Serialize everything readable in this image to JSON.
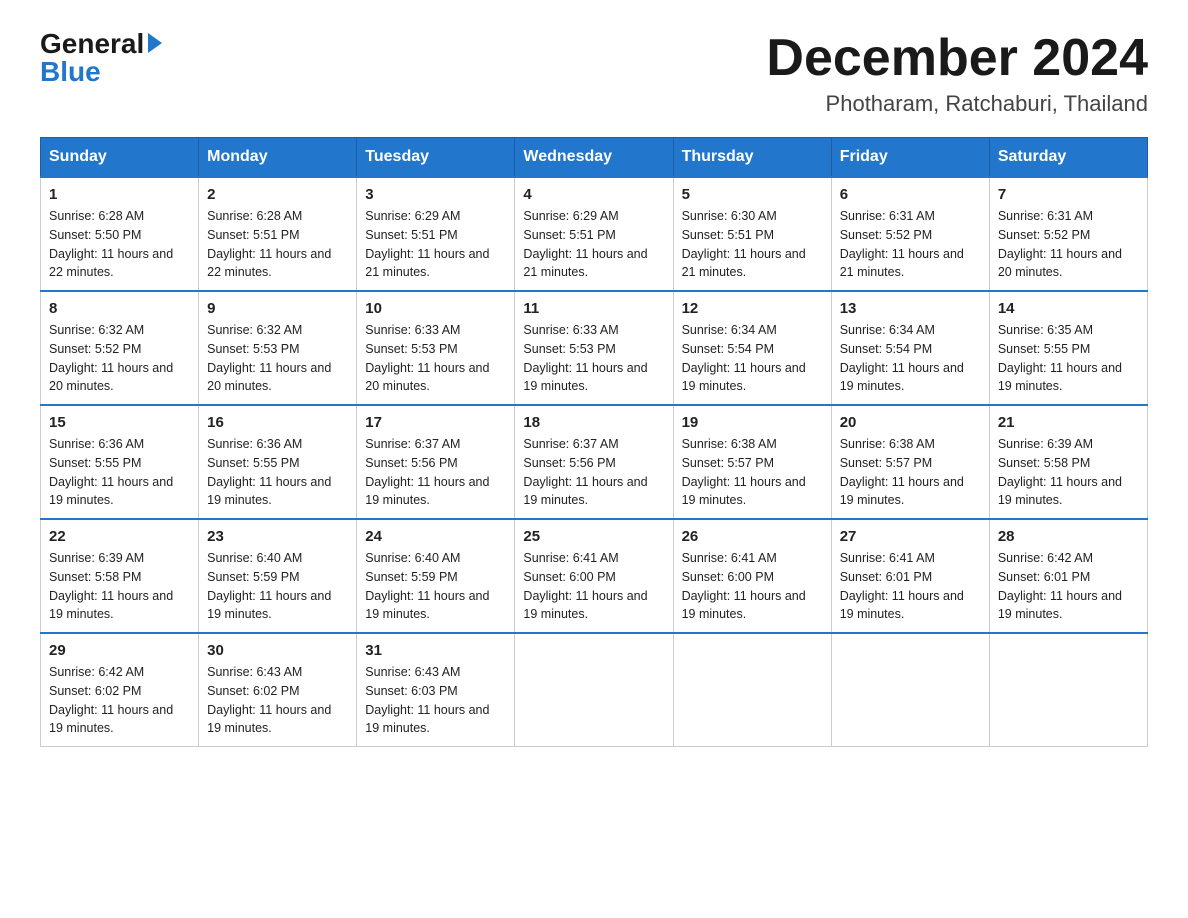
{
  "logo": {
    "general": "General",
    "blue": "Blue"
  },
  "header": {
    "month": "December 2024",
    "location": "Photharam, Ratchaburi, Thailand"
  },
  "days_of_week": [
    "Sunday",
    "Monday",
    "Tuesday",
    "Wednesday",
    "Thursday",
    "Friday",
    "Saturday"
  ],
  "weeks": [
    [
      {
        "day": 1,
        "sunrise": "6:28 AM",
        "sunset": "5:50 PM",
        "daylight": "11 hours and 22 minutes."
      },
      {
        "day": 2,
        "sunrise": "6:28 AM",
        "sunset": "5:51 PM",
        "daylight": "11 hours and 22 minutes."
      },
      {
        "day": 3,
        "sunrise": "6:29 AM",
        "sunset": "5:51 PM",
        "daylight": "11 hours and 21 minutes."
      },
      {
        "day": 4,
        "sunrise": "6:29 AM",
        "sunset": "5:51 PM",
        "daylight": "11 hours and 21 minutes."
      },
      {
        "day": 5,
        "sunrise": "6:30 AM",
        "sunset": "5:51 PM",
        "daylight": "11 hours and 21 minutes."
      },
      {
        "day": 6,
        "sunrise": "6:31 AM",
        "sunset": "5:52 PM",
        "daylight": "11 hours and 21 minutes."
      },
      {
        "day": 7,
        "sunrise": "6:31 AM",
        "sunset": "5:52 PM",
        "daylight": "11 hours and 20 minutes."
      }
    ],
    [
      {
        "day": 8,
        "sunrise": "6:32 AM",
        "sunset": "5:52 PM",
        "daylight": "11 hours and 20 minutes."
      },
      {
        "day": 9,
        "sunrise": "6:32 AM",
        "sunset": "5:53 PM",
        "daylight": "11 hours and 20 minutes."
      },
      {
        "day": 10,
        "sunrise": "6:33 AM",
        "sunset": "5:53 PM",
        "daylight": "11 hours and 20 minutes."
      },
      {
        "day": 11,
        "sunrise": "6:33 AM",
        "sunset": "5:53 PM",
        "daylight": "11 hours and 19 minutes."
      },
      {
        "day": 12,
        "sunrise": "6:34 AM",
        "sunset": "5:54 PM",
        "daylight": "11 hours and 19 minutes."
      },
      {
        "day": 13,
        "sunrise": "6:34 AM",
        "sunset": "5:54 PM",
        "daylight": "11 hours and 19 minutes."
      },
      {
        "day": 14,
        "sunrise": "6:35 AM",
        "sunset": "5:55 PM",
        "daylight": "11 hours and 19 minutes."
      }
    ],
    [
      {
        "day": 15,
        "sunrise": "6:36 AM",
        "sunset": "5:55 PM",
        "daylight": "11 hours and 19 minutes."
      },
      {
        "day": 16,
        "sunrise": "6:36 AM",
        "sunset": "5:55 PM",
        "daylight": "11 hours and 19 minutes."
      },
      {
        "day": 17,
        "sunrise": "6:37 AM",
        "sunset": "5:56 PM",
        "daylight": "11 hours and 19 minutes."
      },
      {
        "day": 18,
        "sunrise": "6:37 AM",
        "sunset": "5:56 PM",
        "daylight": "11 hours and 19 minutes."
      },
      {
        "day": 19,
        "sunrise": "6:38 AM",
        "sunset": "5:57 PM",
        "daylight": "11 hours and 19 minutes."
      },
      {
        "day": 20,
        "sunrise": "6:38 AM",
        "sunset": "5:57 PM",
        "daylight": "11 hours and 19 minutes."
      },
      {
        "day": 21,
        "sunrise": "6:39 AM",
        "sunset": "5:58 PM",
        "daylight": "11 hours and 19 minutes."
      }
    ],
    [
      {
        "day": 22,
        "sunrise": "6:39 AM",
        "sunset": "5:58 PM",
        "daylight": "11 hours and 19 minutes."
      },
      {
        "day": 23,
        "sunrise": "6:40 AM",
        "sunset": "5:59 PM",
        "daylight": "11 hours and 19 minutes."
      },
      {
        "day": 24,
        "sunrise": "6:40 AM",
        "sunset": "5:59 PM",
        "daylight": "11 hours and 19 minutes."
      },
      {
        "day": 25,
        "sunrise": "6:41 AM",
        "sunset": "6:00 PM",
        "daylight": "11 hours and 19 minutes."
      },
      {
        "day": 26,
        "sunrise": "6:41 AM",
        "sunset": "6:00 PM",
        "daylight": "11 hours and 19 minutes."
      },
      {
        "day": 27,
        "sunrise": "6:41 AM",
        "sunset": "6:01 PM",
        "daylight": "11 hours and 19 minutes."
      },
      {
        "day": 28,
        "sunrise": "6:42 AM",
        "sunset": "6:01 PM",
        "daylight": "11 hours and 19 minutes."
      }
    ],
    [
      {
        "day": 29,
        "sunrise": "6:42 AM",
        "sunset": "6:02 PM",
        "daylight": "11 hours and 19 minutes."
      },
      {
        "day": 30,
        "sunrise": "6:43 AM",
        "sunset": "6:02 PM",
        "daylight": "11 hours and 19 minutes."
      },
      {
        "day": 31,
        "sunrise": "6:43 AM",
        "sunset": "6:03 PM",
        "daylight": "11 hours and 19 minutes."
      },
      null,
      null,
      null,
      null
    ]
  ]
}
